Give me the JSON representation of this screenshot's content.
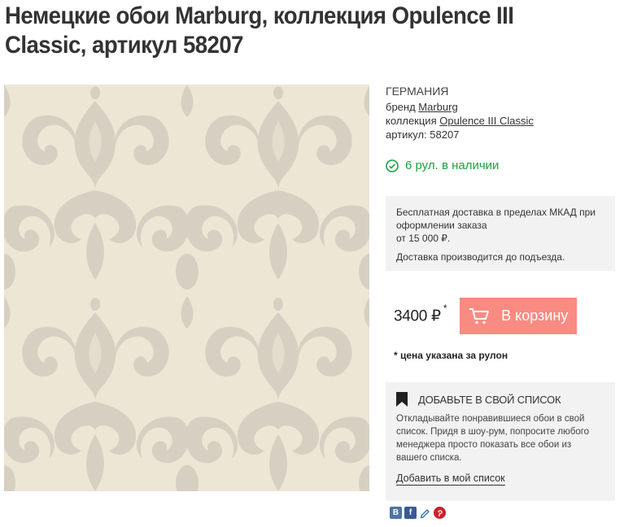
{
  "title": "Немецкие обои Marburg, коллекция Opulence III Classic, артикул 58207",
  "product_image": {
    "alt": "wallpaper-damask-pattern"
  },
  "meta": {
    "country": "ГЕРМАНИЯ",
    "brand_label": "бренд",
    "brand_value": "Marburg",
    "collection_label": "коллекция",
    "collection_value": "Opulence III Classic",
    "article_label": "артикул:",
    "article_value": "58207"
  },
  "stock": {
    "text": "6 рул. в наличии",
    "color": "#1aa23e",
    "icon": "check-circle-icon"
  },
  "delivery": {
    "line1": "Бесплатная доставка в пределах МКАД при оформлении заказа",
    "line2": "от 15 000 ₽.",
    "line3": "Доставка производится до подъезда."
  },
  "price": {
    "value": "3400 ₽",
    "mark": "*"
  },
  "cart_button": {
    "label": "В корзину",
    "color": "#f98b82",
    "icon": "cart-icon"
  },
  "price_note": "* цена указана за рулон",
  "wishlist": {
    "title": "ДОБАВЬТЕ В СВОЙ СПИСОК",
    "icon": "bookmark-icon",
    "description": "Откладывайте понравившиеся обои в свой список. Придя в шоу-рум, попросите любого менеджера просто показать все обои из вашего списка.",
    "link": "Добавить в мой список"
  },
  "share": {
    "vk": "В",
    "fb": "f",
    "icons": [
      "vk-icon",
      "facebook-icon",
      "livejournal-icon",
      "pinterest-icon"
    ]
  }
}
